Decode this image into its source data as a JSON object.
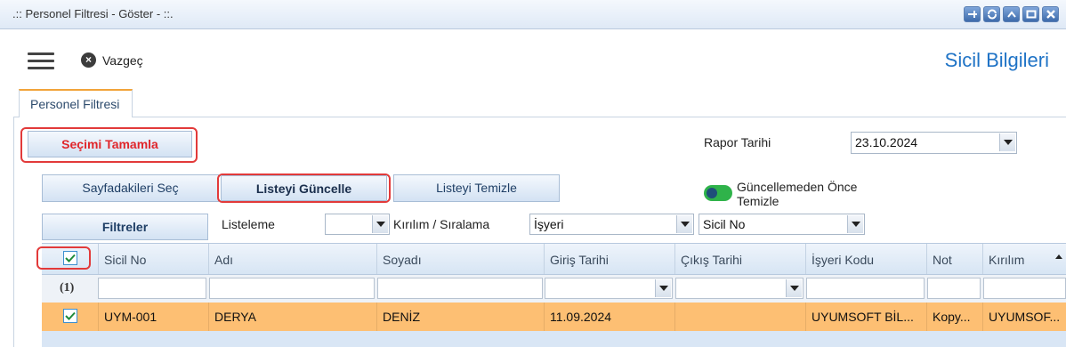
{
  "window": {
    "title": ".:: Personel Filtresi - Göster - ::."
  },
  "header": {
    "cancel_label": "Vazgeç",
    "page_title": "Sicil Bilgileri"
  },
  "tab": {
    "label": "Personel Filtresi"
  },
  "form": {
    "complete_label": "Seçimi Tamamla",
    "report_date_label": "Rapor Tarihi",
    "report_date_value": "23.10.2024",
    "select_page_label": "Sayfadakileri Seç",
    "refresh_list_label": "Listeyi Güncelle",
    "clear_list_label": "Listeyi Temizle",
    "toggle_label": "Güncellemeden Önce Temizle",
    "filters_label": "Filtreler",
    "listing_label": "Listeleme",
    "listing_value": "",
    "grouping_label": "Kırılım / Sıralama",
    "grouping_value_1": "İşyeri",
    "grouping_value_2": "Sicil No"
  },
  "grid": {
    "columns": [
      "Sicil No",
      "Adı",
      "Soyadı",
      "Giriş Tarihi",
      "Çıkış Tarihi",
      "İşyeri Kodu",
      "Not",
      "Kırılım"
    ],
    "filter_row_count": "(1)",
    "rows": [
      {
        "sicil_no": "UYM-001",
        "adi": "DERYA",
        "soyadi": "DENİZ",
        "giris": "11.09.2024",
        "cikis": "",
        "isyeri": "UYUMSOFT BİL...",
        "not": "Kopy...",
        "kirilim": "UYUMSOF..."
      }
    ]
  },
  "colors": {
    "accent": "#1f73c6",
    "selected_row": "#fdbf73",
    "highlight": "#e23a3a",
    "toggle_on": "#2fb34a"
  }
}
